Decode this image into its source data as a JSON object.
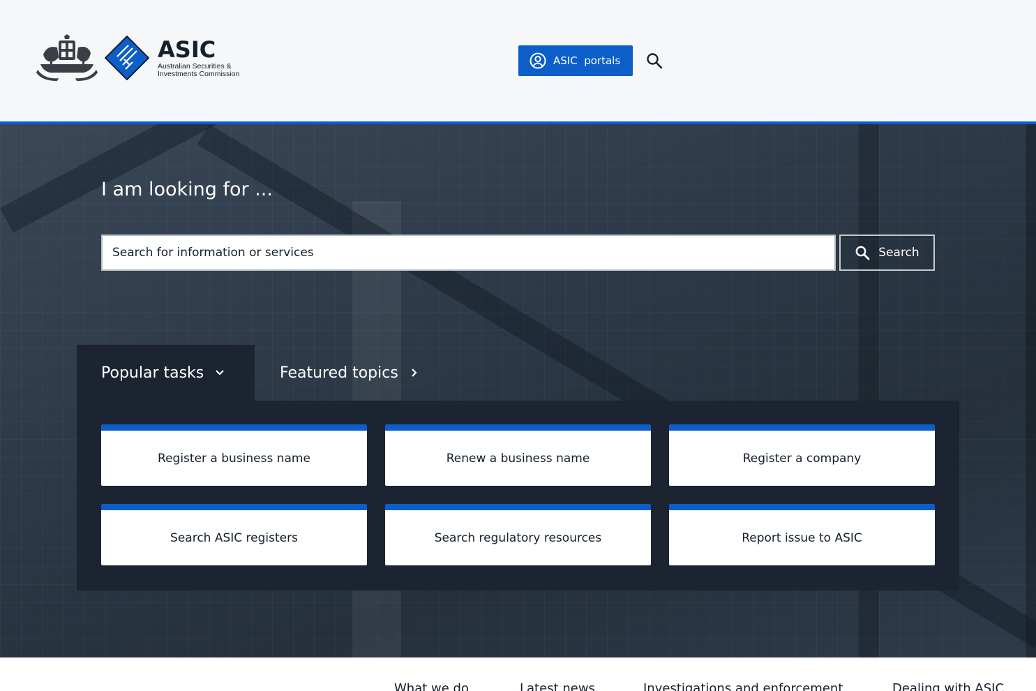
{
  "header": {
    "brand_name": "ASIC",
    "brand_subtitle": "Australian Securities & Investments Commission",
    "portals_label": "ASIC  portals",
    "icons": {
      "portals": "user-circle-icon",
      "search": "search-icon"
    }
  },
  "hero": {
    "title": "I am looking for ...",
    "search_placeholder": "Search for information or services",
    "search_button": "Search"
  },
  "tabs": [
    {
      "label": "Popular tasks",
      "active": true,
      "icon": "chevron-down-icon"
    },
    {
      "label": "Featured topics",
      "active": false,
      "icon": "chevron-right-icon"
    }
  ],
  "tasks": [
    {
      "label": "Register a business name"
    },
    {
      "label": "Renew a business name"
    },
    {
      "label": "Register a company"
    },
    {
      "label": "Search ASIC registers"
    },
    {
      "label": "Search regulatory resources"
    },
    {
      "label": "Report issue to ASIC"
    }
  ],
  "footer_nav": [
    {
      "label": "What we do"
    },
    {
      "label": "Latest news"
    },
    {
      "label": "Investigations and enforcement"
    },
    {
      "label": "Dealing with ASIC"
    }
  ],
  "colors": {
    "accent": "#0c5ec8",
    "panel": "#1b2430",
    "text": "#14202e"
  }
}
